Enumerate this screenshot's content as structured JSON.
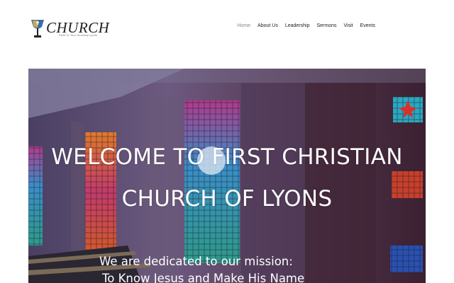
{
  "logo": {
    "wordmark": "CHURCH",
    "tagline": "Faith To Your Doorstep Lyons"
  },
  "nav": [
    {
      "label": "Home"
    },
    {
      "label": "About Us"
    },
    {
      "label": "Leadership"
    },
    {
      "label": "Sermons"
    },
    {
      "label": "Visit"
    },
    {
      "label": "Events"
    }
  ],
  "hero": {
    "title": "WELCOME TO FIRST CHRISTIAN CHURCH OF LYONS",
    "subtitle_line1": "We are dedicated to our mission:",
    "subtitle_line2": "To Know Jesus and Make His Name"
  },
  "colors": {
    "nav_active": "#888888",
    "text": "#222222"
  },
  "icons": [
    "chalice-logo-icon"
  ]
}
